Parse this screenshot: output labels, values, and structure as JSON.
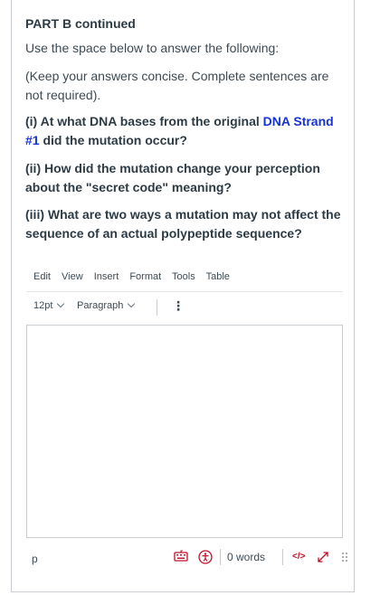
{
  "section": {
    "heading": "PART B continued",
    "instruction": "Use the space below to answer the following:",
    "note": "(Keep your answers concise.  Complete sentences are not required)."
  },
  "questions": [
    {
      "before": "(i) At what DNA bases from the original ",
      "highlight": "DNA Strand #1",
      "after": " did the mutation occur?"
    },
    {
      "text": "(ii) How did the mutation change your perception about the \"secret code\" meaning?"
    },
    {
      "text": "(iii) What are two ways a mutation may not affect the sequence of an actual polypeptide sequence?"
    }
  ],
  "editor": {
    "menu": [
      "Edit",
      "View",
      "Insert",
      "Format",
      "Tools",
      "Table"
    ],
    "font_size": "12pt",
    "block_format": "Paragraph",
    "content": "",
    "status_path": "p",
    "word_count": "0 words",
    "html_toggle": "</>"
  },
  "colors": {
    "link_blue": "#1533d6",
    "icon_red": "#c0102a",
    "border": "#c7cdd1"
  },
  "icons": [
    "keyboard-icon",
    "accessibility-icon",
    "fullscreen-icon",
    "resize-handle-icon"
  ]
}
